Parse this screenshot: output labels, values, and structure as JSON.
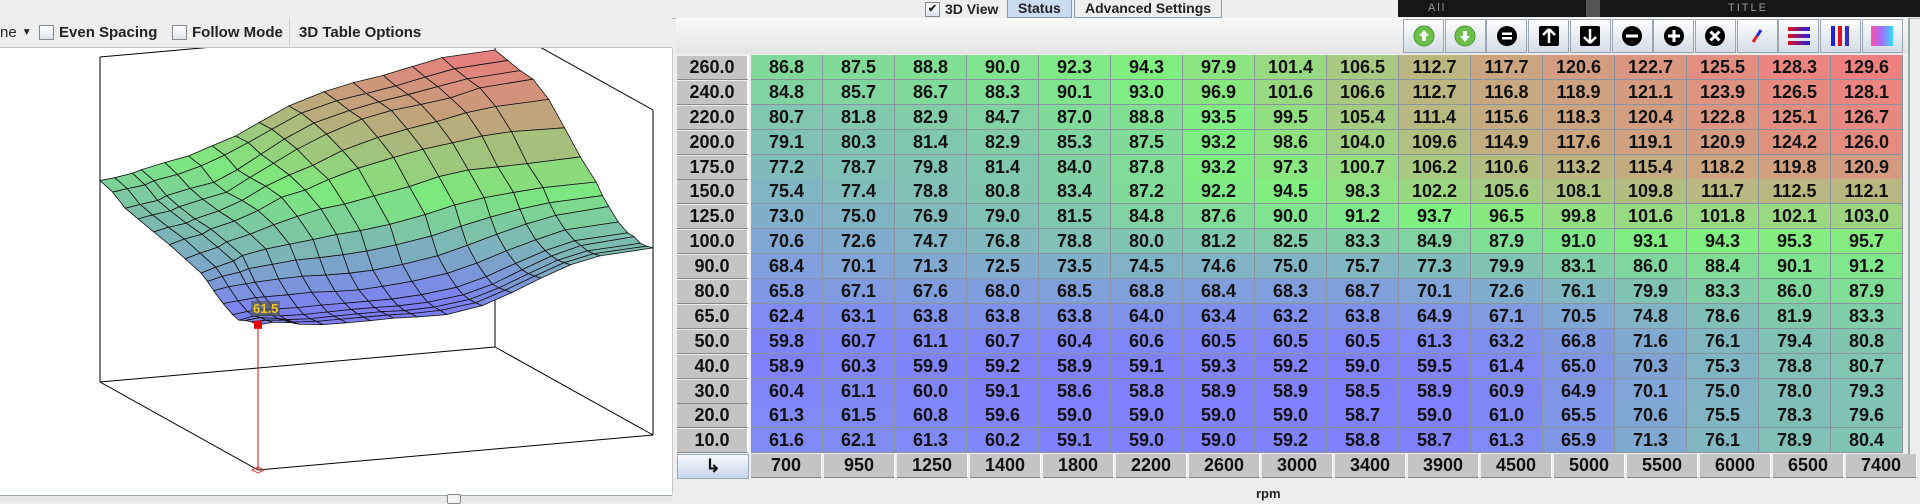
{
  "top": {
    "view_3d_label": "3D View",
    "view_3d_checked": true,
    "tabs": [
      {
        "label": "Status",
        "selected": true
      },
      {
        "label": "Advanced Settings",
        "selected": false
      }
    ],
    "dark_area": {
      "left_text": "All",
      "title_text": "TITLE"
    }
  },
  "left_toolbar": {
    "dropdown_value": "ne",
    "even_spacing_label": "Even Spacing",
    "even_spacing_checked": false,
    "follow_mode_label": "Follow Mode",
    "follow_mode_checked": false,
    "options_label": "3D Table Options"
  },
  "surface": {
    "cursor_value_label": "61.5",
    "cursor_rpm": 700,
    "cursor_load": 10
  },
  "toolbar": {
    "buttons": [
      {
        "icon": "increase-green-icon"
      },
      {
        "icon": "decrease-green-icon"
      },
      {
        "icon": "set-equal-icon"
      },
      {
        "icon": "arrow-up-icon"
      },
      {
        "icon": "arrow-down-icon"
      },
      {
        "icon": "minus-icon"
      },
      {
        "icon": "plus-icon"
      },
      {
        "icon": "multiply-icon"
      },
      {
        "icon": "interpolate-pen-icon"
      },
      {
        "icon": "interpolate-horizontal-icon"
      },
      {
        "icon": "interpolate-vertical-icon"
      },
      {
        "icon": "smooth-gradient-icon"
      }
    ]
  },
  "colors": {
    "low": "#8080ff",
    "mid": "#80f080",
    "high": "#f08080"
  },
  "table": {
    "x_axis_label": "rpm",
    "rpm_axis": [
      "700",
      "950",
      "1250",
      "1400",
      "1800",
      "2200",
      "2600",
      "3000",
      "3400",
      "3900",
      "4500",
      "5000",
      "5500",
      "6000",
      "6500",
      "7400"
    ],
    "load_axis": [
      "260.0",
      "240.0",
      "220.0",
      "200.0",
      "175.0",
      "150.0",
      "125.0",
      "100.0",
      "90.0",
      "80.0",
      "65.0",
      "50.0",
      "40.0",
      "30.0",
      "20.0",
      "10.0"
    ],
    "rows": [
      [
        "86.8",
        "87.5",
        "88.8",
        "90.0",
        "92.3",
        "94.3",
        "97.9",
        "101.4",
        "106.5",
        "112.7",
        "117.7",
        "120.6",
        "122.7",
        "125.5",
        "128.3",
        "129.6"
      ],
      [
        "84.8",
        "85.7",
        "86.7",
        "88.3",
        "90.1",
        "93.0",
        "96.9",
        "101.6",
        "106.6",
        "112.7",
        "116.8",
        "118.9",
        "121.1",
        "123.9",
        "126.5",
        "128.1"
      ],
      [
        "80.7",
        "81.8",
        "82.9",
        "84.7",
        "87.0",
        "88.8",
        "93.5",
        "99.5",
        "105.4",
        "111.4",
        "115.6",
        "118.3",
        "120.4",
        "122.8",
        "125.1",
        "126.7"
      ],
      [
        "79.1",
        "80.3",
        "81.4",
        "82.9",
        "85.3",
        "87.5",
        "93.2",
        "98.6",
        "104.0",
        "109.6",
        "114.9",
        "117.6",
        "119.1",
        "120.9",
        "124.2",
        "126.0"
      ],
      [
        "77.2",
        "78.7",
        "79.8",
        "81.4",
        "84.0",
        "87.8",
        "93.2",
        "97.3",
        "100.7",
        "106.2",
        "110.6",
        "113.2",
        "115.4",
        "118.2",
        "119.8",
        "120.9"
      ],
      [
        "75.4",
        "77.4",
        "78.8",
        "80.8",
        "83.4",
        "87.2",
        "92.2",
        "94.5",
        "98.3",
        "102.2",
        "105.6",
        "108.1",
        "109.8",
        "111.7",
        "112.5",
        "112.1"
      ],
      [
        "73.0",
        "75.0",
        "76.9",
        "79.0",
        "81.5",
        "84.8",
        "87.6",
        "90.0",
        "91.2",
        "93.7",
        "96.5",
        "99.8",
        "101.6",
        "101.8",
        "102.1",
        "103.0"
      ],
      [
        "70.6",
        "72.6",
        "74.7",
        "76.8",
        "78.8",
        "80.0",
        "81.2",
        "82.5",
        "83.3",
        "84.9",
        "87.9",
        "91.0",
        "93.1",
        "94.3",
        "95.3",
        "95.7"
      ],
      [
        "68.4",
        "70.1",
        "71.3",
        "72.5",
        "73.5",
        "74.5",
        "74.6",
        "75.0",
        "75.7",
        "77.3",
        "79.9",
        "83.1",
        "86.0",
        "88.4",
        "90.1",
        "91.2"
      ],
      [
        "65.8",
        "67.1",
        "67.6",
        "68.0",
        "68.5",
        "68.8",
        "68.4",
        "68.3",
        "68.7",
        "70.1",
        "72.6",
        "76.1",
        "79.9",
        "83.3",
        "86.0",
        "87.9"
      ],
      [
        "62.4",
        "63.1",
        "63.8",
        "63.8",
        "63.8",
        "64.0",
        "63.4",
        "63.2",
        "63.8",
        "64.9",
        "67.1",
        "70.5",
        "74.8",
        "78.6",
        "81.9",
        "83.3"
      ],
      [
        "59.8",
        "60.7",
        "61.1",
        "60.7",
        "60.4",
        "60.6",
        "60.5",
        "60.5",
        "60.5",
        "61.3",
        "63.2",
        "66.8",
        "71.6",
        "76.1",
        "79.4",
        "80.8"
      ],
      [
        "58.9",
        "60.3",
        "59.9",
        "59.2",
        "58.9",
        "59.1",
        "59.3",
        "59.2",
        "59.0",
        "59.5",
        "61.4",
        "65.0",
        "70.3",
        "75.3",
        "78.8",
        "80.7"
      ],
      [
        "60.4",
        "61.1",
        "60.0",
        "59.1",
        "58.6",
        "58.8",
        "58.9",
        "58.9",
        "58.5",
        "58.9",
        "60.9",
        "64.9",
        "70.1",
        "75.0",
        "78.0",
        "79.3"
      ],
      [
        "61.3",
        "61.5",
        "60.8",
        "59.6",
        "59.0",
        "59.0",
        "59.0",
        "59.0",
        "58.7",
        "59.0",
        "61.0",
        "65.5",
        "70.6",
        "75.5",
        "78.3",
        "79.6"
      ],
      [
        "61.6",
        "62.1",
        "61.3",
        "60.2",
        "59.1",
        "59.0",
        "59.0",
        "59.2",
        "58.8",
        "58.7",
        "61.3",
        "65.9",
        "71.3",
        "76.1",
        "78.9",
        "80.4"
      ]
    ]
  }
}
